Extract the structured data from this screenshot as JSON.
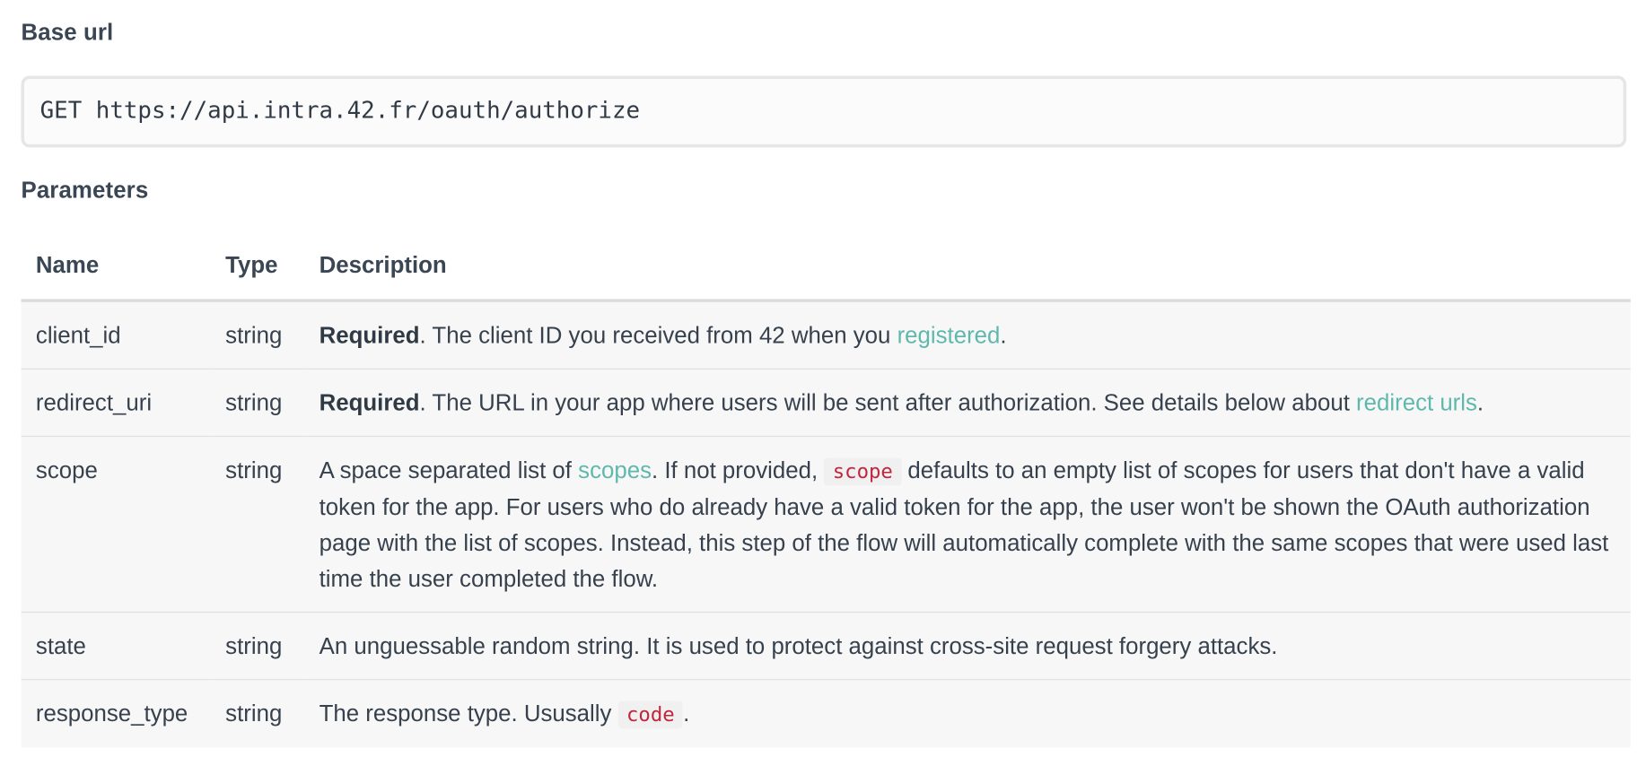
{
  "base_url": {
    "heading": "Base url",
    "code": "GET https://api.intra.42.fr/oauth/authorize"
  },
  "parameters": {
    "heading": "Parameters",
    "columns": [
      "Name",
      "Type",
      "Description"
    ],
    "rows": [
      {
        "name": "client_id",
        "type": "string",
        "desc": {
          "required": "Required",
          "pre": ". The client ID you received from 42 when you ",
          "link": "registered",
          "post": "."
        }
      },
      {
        "name": "redirect_uri",
        "type": "string",
        "desc": {
          "required": "Required",
          "pre": ". The URL in your app where users will be sent after authorization. See details below about ",
          "link": "redirect urls",
          "post": "."
        }
      },
      {
        "name": "scope",
        "type": "string",
        "desc": {
          "pre": "A space separated list of ",
          "link": "scopes",
          "mid": ". If not provided, ",
          "code": "scope",
          "post": " defaults to an empty list of scopes for users that don't have a valid token for the app. For users who do already have a valid token for the app, the user won't be shown the OAuth authorization page with the list of scopes. Instead, this step of the flow will automatically complete with the same scopes that were used last time the user completed the flow."
        }
      },
      {
        "name": "state",
        "type": "string",
        "desc": {
          "text": "An unguessable random string. It is used to protect against cross-site request forgery attacks."
        }
      },
      {
        "name": "response_type",
        "type": "string",
        "desc": {
          "pre": "The response type. Ususally ",
          "code": "code",
          "post": "."
        }
      }
    ]
  },
  "colors": {
    "link": "#5fb8ac",
    "code_text": "#c0273e",
    "heading": "#3a4654"
  }
}
